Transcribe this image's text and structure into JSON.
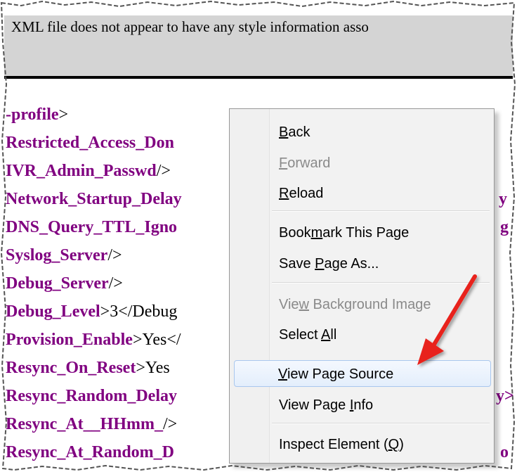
{
  "banner": {
    "text": "XML file does not appear to have any style information asso"
  },
  "xml_lines": [
    {
      "tag": "-profile",
      "rest": ">"
    },
    {
      "tag": "Restricted_Access_Don",
      "rest": ""
    },
    {
      "tag": "IVR_Admin_Passwd",
      "rest": "/>"
    },
    {
      "tag": "Network_Startup_Delay",
      "rest": ""
    },
    {
      "tag": "DNS_Query_TTL_Igno",
      "rest": ""
    },
    {
      "tag": "Syslog_Server",
      "rest": "/>"
    },
    {
      "tag": "Debug_Server",
      "rest": "/>"
    },
    {
      "tag": "Debug_Level",
      "rest": ">3</Debug"
    },
    {
      "tag": "Provision_Enable",
      "rest": ">Yes</"
    },
    {
      "tag": "Resync_On_Reset",
      "rest": ">Yes"
    },
    {
      "tag": "Resync_Random_Delay",
      "rest": ""
    },
    {
      "tag": "Resync_At__HHmm_",
      "rest": "/>"
    },
    {
      "tag": "Resync_At_Random_D",
      "rest": ""
    }
  ],
  "right_fragments": {
    "network": "y",
    "dns": "g",
    "resync_random": "y>",
    "resync_at_random": "o"
  },
  "context_menu": {
    "items": [
      {
        "label": "Back",
        "accesskey_index": 0,
        "disabled": false
      },
      {
        "label": "Forward",
        "accesskey_index": 0,
        "disabled": true
      },
      {
        "label": "Reload",
        "accesskey_index": 0,
        "disabled": false
      },
      {
        "label": "Bookmark This Page",
        "accesskey_index": 4,
        "disabled": false
      },
      {
        "label": "Save Page As...",
        "accesskey_index": 5,
        "disabled": false
      },
      {
        "label": "View Background Image",
        "accesskey_index": 3,
        "disabled": true
      },
      {
        "label": "Select All",
        "accesskey_index": 7,
        "disabled": false
      },
      {
        "label": "View Page Source",
        "accesskey_index": 0,
        "disabled": false,
        "highlighted": true
      },
      {
        "label": "View Page Info",
        "accesskey_index": 10,
        "disabled": false
      },
      {
        "label": "Inspect Element (Q)",
        "accesskey_index": 17,
        "disabled": false
      }
    ]
  },
  "colors": {
    "xml_tag": "#800080",
    "arrow": "#e8201a",
    "menu_highlight_border": "#a9c7ee"
  },
  "icons": {
    "annotation": "red-arrow-icon"
  }
}
